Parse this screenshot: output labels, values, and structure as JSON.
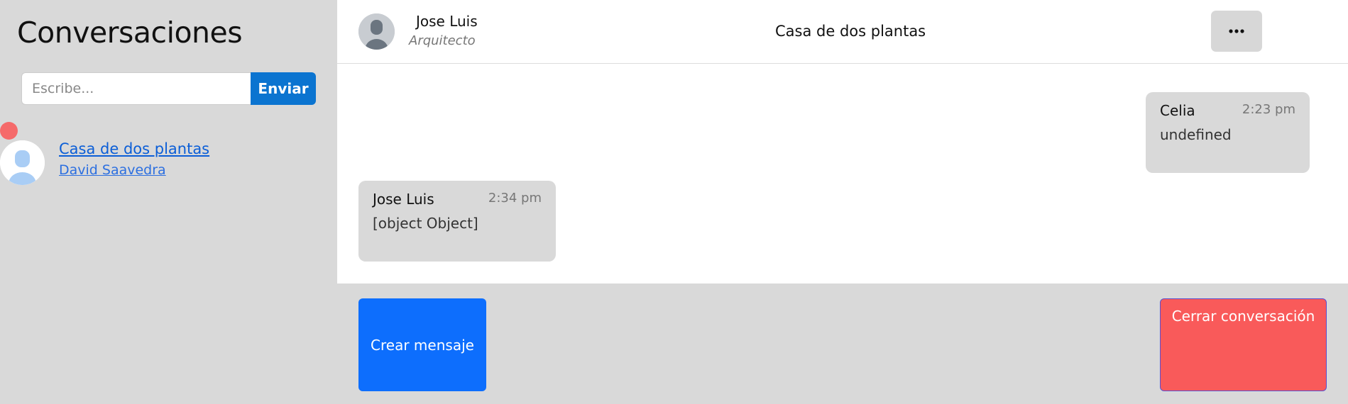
{
  "sidebar": {
    "title": "Conversaciones",
    "search": {
      "placeholder": "Escribe...",
      "value": "",
      "button_label": "Enviar"
    },
    "conversations": [
      {
        "title": "Casa de dos plantas",
        "subtitle": "David Saavedra",
        "unread": true,
        "avatar_icon": "user-avatar-icon"
      }
    ]
  },
  "header": {
    "name": "Jose Luis",
    "role": "Arquitecto",
    "title": "Casa de dos plantas",
    "more_icon": "ellipsis-icon"
  },
  "messages": [
    {
      "author": "Celia",
      "time": "2:23 pm",
      "text": "undefined",
      "side": "right"
    },
    {
      "author": "Jose Luis",
      "time": "2:34 pm",
      "text": "[object Object]",
      "side": "left"
    }
  ],
  "footer": {
    "create_label": "Crear mensaje",
    "close_label": "Cerrar conversación"
  },
  "colors": {
    "primary": "#0d6efd",
    "send_button": "#0b74d0",
    "danger": "#f95a5a",
    "unread_dot": "#f56a6a",
    "background": "#d9d9d9",
    "bubble": "#d9d9d9"
  }
}
